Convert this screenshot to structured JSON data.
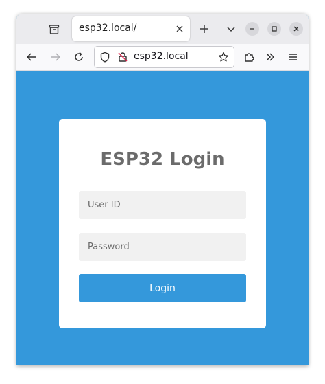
{
  "browser": {
    "tab": {
      "title": "esp32.local/"
    },
    "address_bar": {
      "url": "esp32.local"
    }
  },
  "icons": {
    "tab_list": "tab-list-icon",
    "tab_close": "close-icon",
    "new_tab": "plus-icon",
    "list_all_tabs": "chevron-down-icon",
    "minimize": "minimize-icon",
    "maximize": "maximize-icon",
    "close_window": "close-window-icon",
    "back": "arrow-left-icon",
    "forward": "arrow-right-icon",
    "reload": "reload-icon",
    "tracking_protection": "shield-icon",
    "insecure_connection": "insecure-lock-icon",
    "bookmark": "star-icon",
    "extensions": "puzzle-icon",
    "overflow": "double-chevron-icon",
    "menu": "hamburger-menu-icon"
  },
  "page": {
    "title": "ESP32 Login",
    "user_id": {
      "value": "",
      "placeholder": "User ID"
    },
    "password": {
      "value": "",
      "placeholder": "Password"
    },
    "login_button": "Login"
  },
  "colors": {
    "page_background": "#3498db",
    "button_background": "#3498db",
    "card_background": "#ffffff",
    "title_text": "#6b6b6b",
    "input_background": "#f1f1f1"
  }
}
